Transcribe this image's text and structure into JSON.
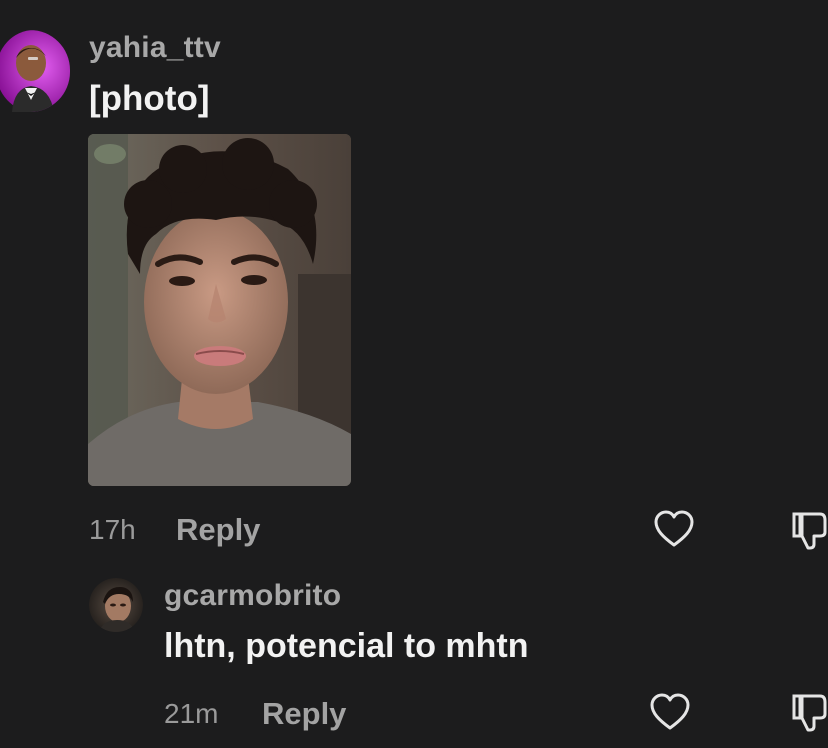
{
  "comments": [
    {
      "username": "yahia_ttv",
      "text": "[photo]",
      "time": "17h",
      "reply_label": "Reply"
    },
    {
      "username": "gcarmobrito",
      "text": "lhtn, potencial to mhtn",
      "time": "21m",
      "reply_label": "Reply"
    }
  ],
  "icons": {
    "like": "heart-outline-icon",
    "dislike": "thumbs-down-outline-icon"
  },
  "colors": {
    "background": "#1c1c1d",
    "username": "#a8a8a8",
    "text": "#f2f2f2",
    "meta": "#9a9a9a",
    "avatar_accent": "#b51fc4"
  }
}
